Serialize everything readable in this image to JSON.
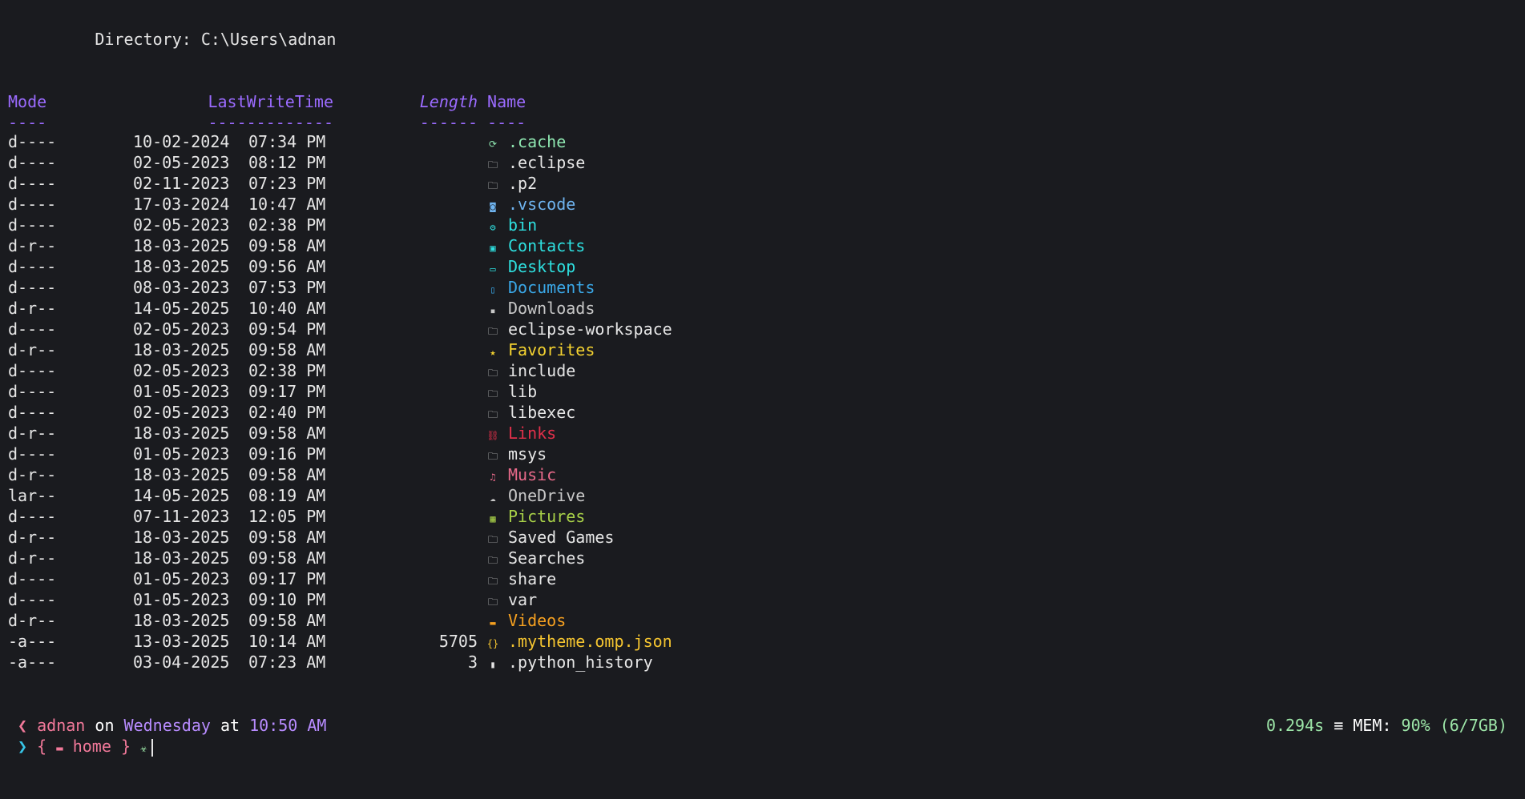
{
  "directory_line": "Directory: C:\\Users\\adnan",
  "headers": {
    "mode": "Mode",
    "lastwritetime": "LastWriteTime",
    "length": "Length",
    "name": "Name",
    "mode_sep": "----",
    "lastwritetime_sep": "-------------",
    "length_sep": "------",
    "name_sep": "----"
  },
  "colors": {
    "header": "#9b6bff",
    "background": "#1a1b1f"
  },
  "entries": [
    {
      "mode": "d----",
      "date": "10-02-2024",
      "time": "07:34 PM",
      "length": "",
      "icon": "cache-icon",
      "icon_glyph": "⟳",
      "name": ".cache",
      "color": "#8ee6b0"
    },
    {
      "mode": "d----",
      "date": "02-05-2023",
      "time": "08:12 PM",
      "length": "",
      "icon": "folder-icon",
      "icon_glyph": "🗀",
      "name": ".eclipse",
      "color": "#e6e6e6"
    },
    {
      "mode": "d----",
      "date": "02-11-2023",
      "time": "07:23 PM",
      "length": "",
      "icon": "folder-icon",
      "icon_glyph": "🗀",
      "name": ".p2",
      "color": "#e6e6e6"
    },
    {
      "mode": "d----",
      "date": "17-03-2024",
      "time": "10:47 AM",
      "length": "",
      "icon": "vscode-icon",
      "icon_glyph": "◙",
      "name": ".vscode",
      "color": "#6fb4f0"
    },
    {
      "mode": "d----",
      "date": "02-05-2023",
      "time": "02:38 PM",
      "length": "",
      "icon": "bin-icon",
      "icon_glyph": "⚙",
      "name": "bin",
      "color": "#2ee0e0"
    },
    {
      "mode": "d-r--",
      "date": "18-03-2025",
      "time": "09:58 AM",
      "length": "",
      "icon": "contacts-icon",
      "icon_glyph": "▣",
      "name": "Contacts",
      "color": "#2ee0e0"
    },
    {
      "mode": "d----",
      "date": "18-03-2025",
      "time": "09:56 AM",
      "length": "",
      "icon": "desktop-icon",
      "icon_glyph": "▭",
      "name": "Desktop",
      "color": "#2ee0e0"
    },
    {
      "mode": "d----",
      "date": "08-03-2023",
      "time": "07:53 PM",
      "length": "",
      "icon": "documents-icon",
      "icon_glyph": "▯",
      "name": "Documents",
      "color": "#3aa8e8"
    },
    {
      "mode": "d-r--",
      "date": "14-05-2025",
      "time": "10:40 AM",
      "length": "",
      "icon": "downloads-icon",
      "icon_glyph": "▪",
      "name": "Downloads",
      "color": "#c8c8c8"
    },
    {
      "mode": "d----",
      "date": "02-05-2023",
      "time": "09:54 PM",
      "length": "",
      "icon": "folder-icon",
      "icon_glyph": "🗀",
      "name": "eclipse-workspace",
      "color": "#e6e6e6"
    },
    {
      "mode": "d-r--",
      "date": "18-03-2025",
      "time": "09:58 AM",
      "length": "",
      "icon": "favorites-icon",
      "icon_glyph": "★",
      "name": "Favorites",
      "color": "#f5d330"
    },
    {
      "mode": "d----",
      "date": "02-05-2023",
      "time": "02:38 PM",
      "length": "",
      "icon": "folder-icon",
      "icon_glyph": "🗀",
      "name": "include",
      "color": "#e6e6e6"
    },
    {
      "mode": "d----",
      "date": "01-05-2023",
      "time": "09:17 PM",
      "length": "",
      "icon": "folder-icon",
      "icon_glyph": "🗀",
      "name": "lib",
      "color": "#e6e6e6"
    },
    {
      "mode": "d----",
      "date": "02-05-2023",
      "time": "02:40 PM",
      "length": "",
      "icon": "folder-icon",
      "icon_glyph": "🗀",
      "name": "libexec",
      "color": "#e6e6e6"
    },
    {
      "mode": "d-r--",
      "date": "18-03-2025",
      "time": "09:58 AM",
      "length": "",
      "icon": "links-icon",
      "icon_glyph": "⛓",
      "name": "Links",
      "color": "#e0304a"
    },
    {
      "mode": "d----",
      "date": "01-05-2023",
      "time": "09:16 PM",
      "length": "",
      "icon": "folder-icon",
      "icon_glyph": "🗀",
      "name": "msys",
      "color": "#e6e6e6"
    },
    {
      "mode": "d-r--",
      "date": "18-03-2025",
      "time": "09:58 AM",
      "length": "",
      "icon": "music-icon",
      "icon_glyph": "♫",
      "name": "Music",
      "color": "#e86a8a"
    },
    {
      "mode": "lar--",
      "date": "14-05-2025",
      "time": "08:19 AM",
      "length": "",
      "icon": "onedrive-icon",
      "icon_glyph": "☁",
      "name": "OneDrive",
      "color": "#c8c8c8"
    },
    {
      "mode": "d----",
      "date": "07-11-2023",
      "time": "12:05 PM",
      "length": "",
      "icon": "pictures-icon",
      "icon_glyph": "▦",
      "name": "Pictures",
      "color": "#a8d048"
    },
    {
      "mode": "d-r--",
      "date": "18-03-2025",
      "time": "09:58 AM",
      "length": "",
      "icon": "folder-icon",
      "icon_glyph": "🗀",
      "name": "Saved Games",
      "color": "#e6e6e6"
    },
    {
      "mode": "d-r--",
      "date": "18-03-2025",
      "time": "09:58 AM",
      "length": "",
      "icon": "folder-icon",
      "icon_glyph": "🗀",
      "name": "Searches",
      "color": "#e6e6e6"
    },
    {
      "mode": "d----",
      "date": "01-05-2023",
      "time": "09:17 PM",
      "length": "",
      "icon": "folder-icon",
      "icon_glyph": "🗀",
      "name": "share",
      "color": "#e6e6e6"
    },
    {
      "mode": "d----",
      "date": "01-05-2023",
      "time": "09:10 PM",
      "length": "",
      "icon": "folder-icon",
      "icon_glyph": "🗀",
      "name": "var",
      "color": "#e6e6e6"
    },
    {
      "mode": "d-r--",
      "date": "18-03-2025",
      "time": "09:58 AM",
      "length": "",
      "icon": "videos-icon",
      "icon_glyph": "▬",
      "name": "Videos",
      "color": "#f5a020"
    },
    {
      "mode": "-a---",
      "date": "13-03-2025",
      "time": "10:14 AM",
      "length": "5705",
      "icon": "json-icon",
      "icon_glyph": "{}",
      "name": ".mytheme.omp.json",
      "color": "#f5c530"
    },
    {
      "mode": "-a---",
      "date": "03-04-2025",
      "time": "07:23 AM",
      "length": "3",
      "icon": "file-icon",
      "icon_glyph": "▮",
      "name": ".python_history",
      "color": "#e6e6e6"
    }
  ],
  "prompt": {
    "arrow_left": "❮",
    "user": "adnan",
    "on": "on",
    "day": "Wednesday",
    "at": "at",
    "time": "10:50 AM",
    "arrow_right": "❯",
    "open_brace": "{",
    "folder_glyph": "▬",
    "folder": "home",
    "close_brace": "}",
    "extra_glyph": "☣"
  },
  "status": {
    "exec_time": "0.294s",
    "mem_glyph": "≡",
    "mem_label": "MEM:",
    "mem_value": "90% (6/7GB)"
  }
}
